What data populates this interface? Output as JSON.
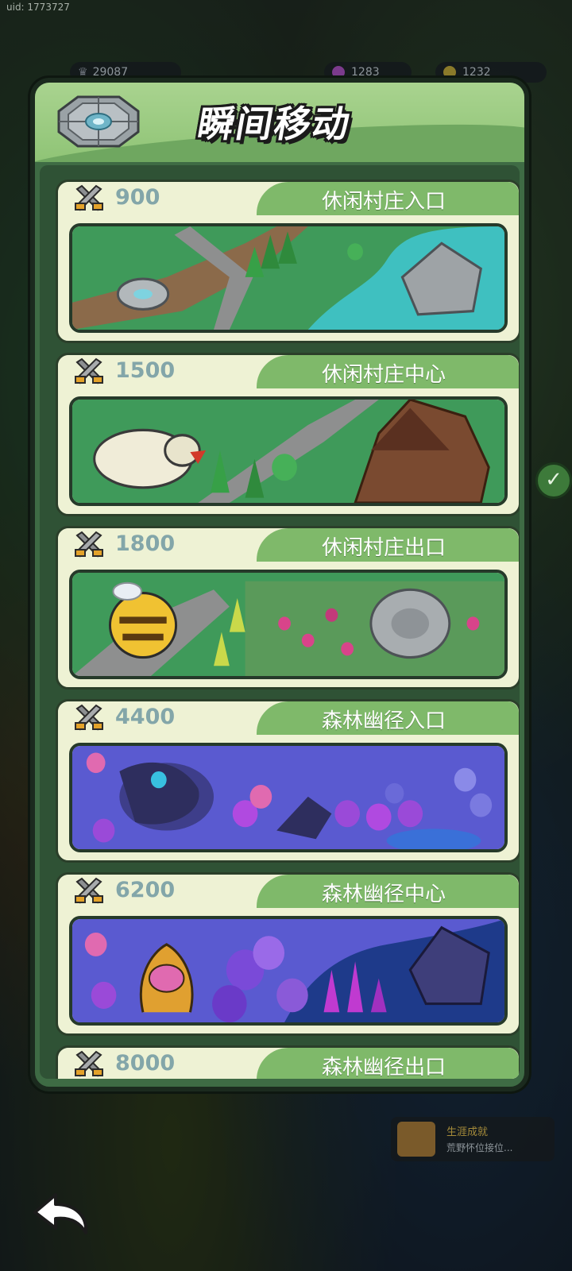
{
  "hud": {
    "uid": "uid: 1773727",
    "trophy": "29087",
    "gems": "1283",
    "coins": "1232"
  },
  "panel": {
    "title": "瞬间移动"
  },
  "entries": [
    {
      "cost": "900",
      "name": "休闲村庄入口"
    },
    {
      "cost": "1500",
      "name": "休闲村庄中心"
    },
    {
      "cost": "1800",
      "name": "休闲村庄出口"
    },
    {
      "cost": "4400",
      "name": "森林幽径入口"
    },
    {
      "cost": "6200",
      "name": "森林幽径中心"
    },
    {
      "cost": "8000",
      "name": "森林幽径出口"
    }
  ],
  "quest": {
    "title": "生涯成就",
    "desc": "荒野怀位接位..."
  },
  "colors": {
    "panel": "#3e6b44",
    "header": "#a9d38f",
    "tab": "#7fb96a",
    "card": "#eef2d4",
    "cost_text": "#83a6a9"
  }
}
